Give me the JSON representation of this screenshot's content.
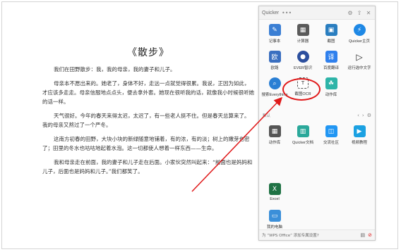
{
  "document": {
    "title": "《散步》",
    "paragraphs": [
      "我们在田野散步：我，我的母亲，我的妻子和儿子。",
      "母亲本不愿出来的。她老了，身体不好，走远一点就觉得很累。我说，正因为如此，才应该多走走。母亲信服地点点头，便去拿外套。她现在很听我的话，就像我小时候很听她的话一样。",
      "天气很好。今年的春天来得太迟，太迟了，有一些老人挺不住。但是春天总算来了。我的母亲又熬过了一个严冬。",
      "这南方初春的田野，大块小块的新绿随意地铺着，有的浓，有的淡；树上的嫩芽也密了；田里的冬水也咕咕地起着水泡。这一切都使人想着一样东西——生命。",
      "我和母亲走在前面，我的妻子和儿子走在后面。小家伙突然叫起来：“前面也是妈妈和儿子，后面也是妈妈和儿子。”我们都笑了。"
    ]
  },
  "panel": {
    "title": "Quicker",
    "header_icons": [
      "more-icon",
      "settings-icon",
      "pin-icon",
      "close-icon"
    ],
    "top_actions": [
      {
        "label": "记事本",
        "icon": "notepad-icon",
        "color": "#3b7fd4"
      },
      {
        "label": "计算器",
        "icon": "calculator-icon",
        "color": "#5a5a5a"
      },
      {
        "label": "截图",
        "icon": "screenshot-icon",
        "color": "#2a7ec0"
      },
      {
        "label": "Quicker主页",
        "icon": "quicker-home-icon",
        "color": "#1e88e5"
      },
      {
        "label": "欧路",
        "icon": "eudic-icon",
        "color": "#3a6fc0"
      },
      {
        "label": "EVER智识",
        "icon": "ever-icon",
        "color": "#2c4f9e"
      },
      {
        "label": "百度翻译",
        "icon": "baidu-translate-icon",
        "color": "#2f80ed"
      },
      {
        "label": "运行选中文字",
        "icon": "run-icon",
        "color": "#222222"
      },
      {
        "label": "搜索Everything",
        "icon": "everything-search-icon",
        "color": "#2a7fd4"
      },
      {
        "label": "截图OCR",
        "icon": "ocr-icon",
        "color": "#ffffff"
      },
      {
        "label": "动作库",
        "icon": "action-library-icon",
        "color": "#2eb4a8"
      }
    ],
    "section_label": "默认",
    "section_icons": [
      "chevron-left-icon",
      "chevron-right-icon",
      "gear-icon"
    ],
    "mid_actions": [
      {
        "label": "动作库",
        "icon": "grid-icon",
        "color": "#555555"
      },
      {
        "label": "Quicker文档",
        "icon": "book-icon",
        "color": "#2aa89a"
      },
      {
        "label": "交流社区",
        "icon": "community-icon",
        "color": "#2196f3"
      },
      {
        "label": "视频教程",
        "icon": "video-icon",
        "color": "#1ba1e2"
      }
    ],
    "bottom_actions": [
      {
        "label": "Excel",
        "icon": "excel-icon",
        "color": "#1f7244"
      },
      {
        "label": "我的电脑",
        "icon": "computer-icon",
        "color": "#3b8fd9"
      }
    ],
    "footer_text": "为 “WPS Office” 添加专属设置?",
    "footer_icons": [
      "folder-icon",
      "disable-icon"
    ]
  },
  "annotation": {
    "highlight_color": "#e0191a"
  }
}
